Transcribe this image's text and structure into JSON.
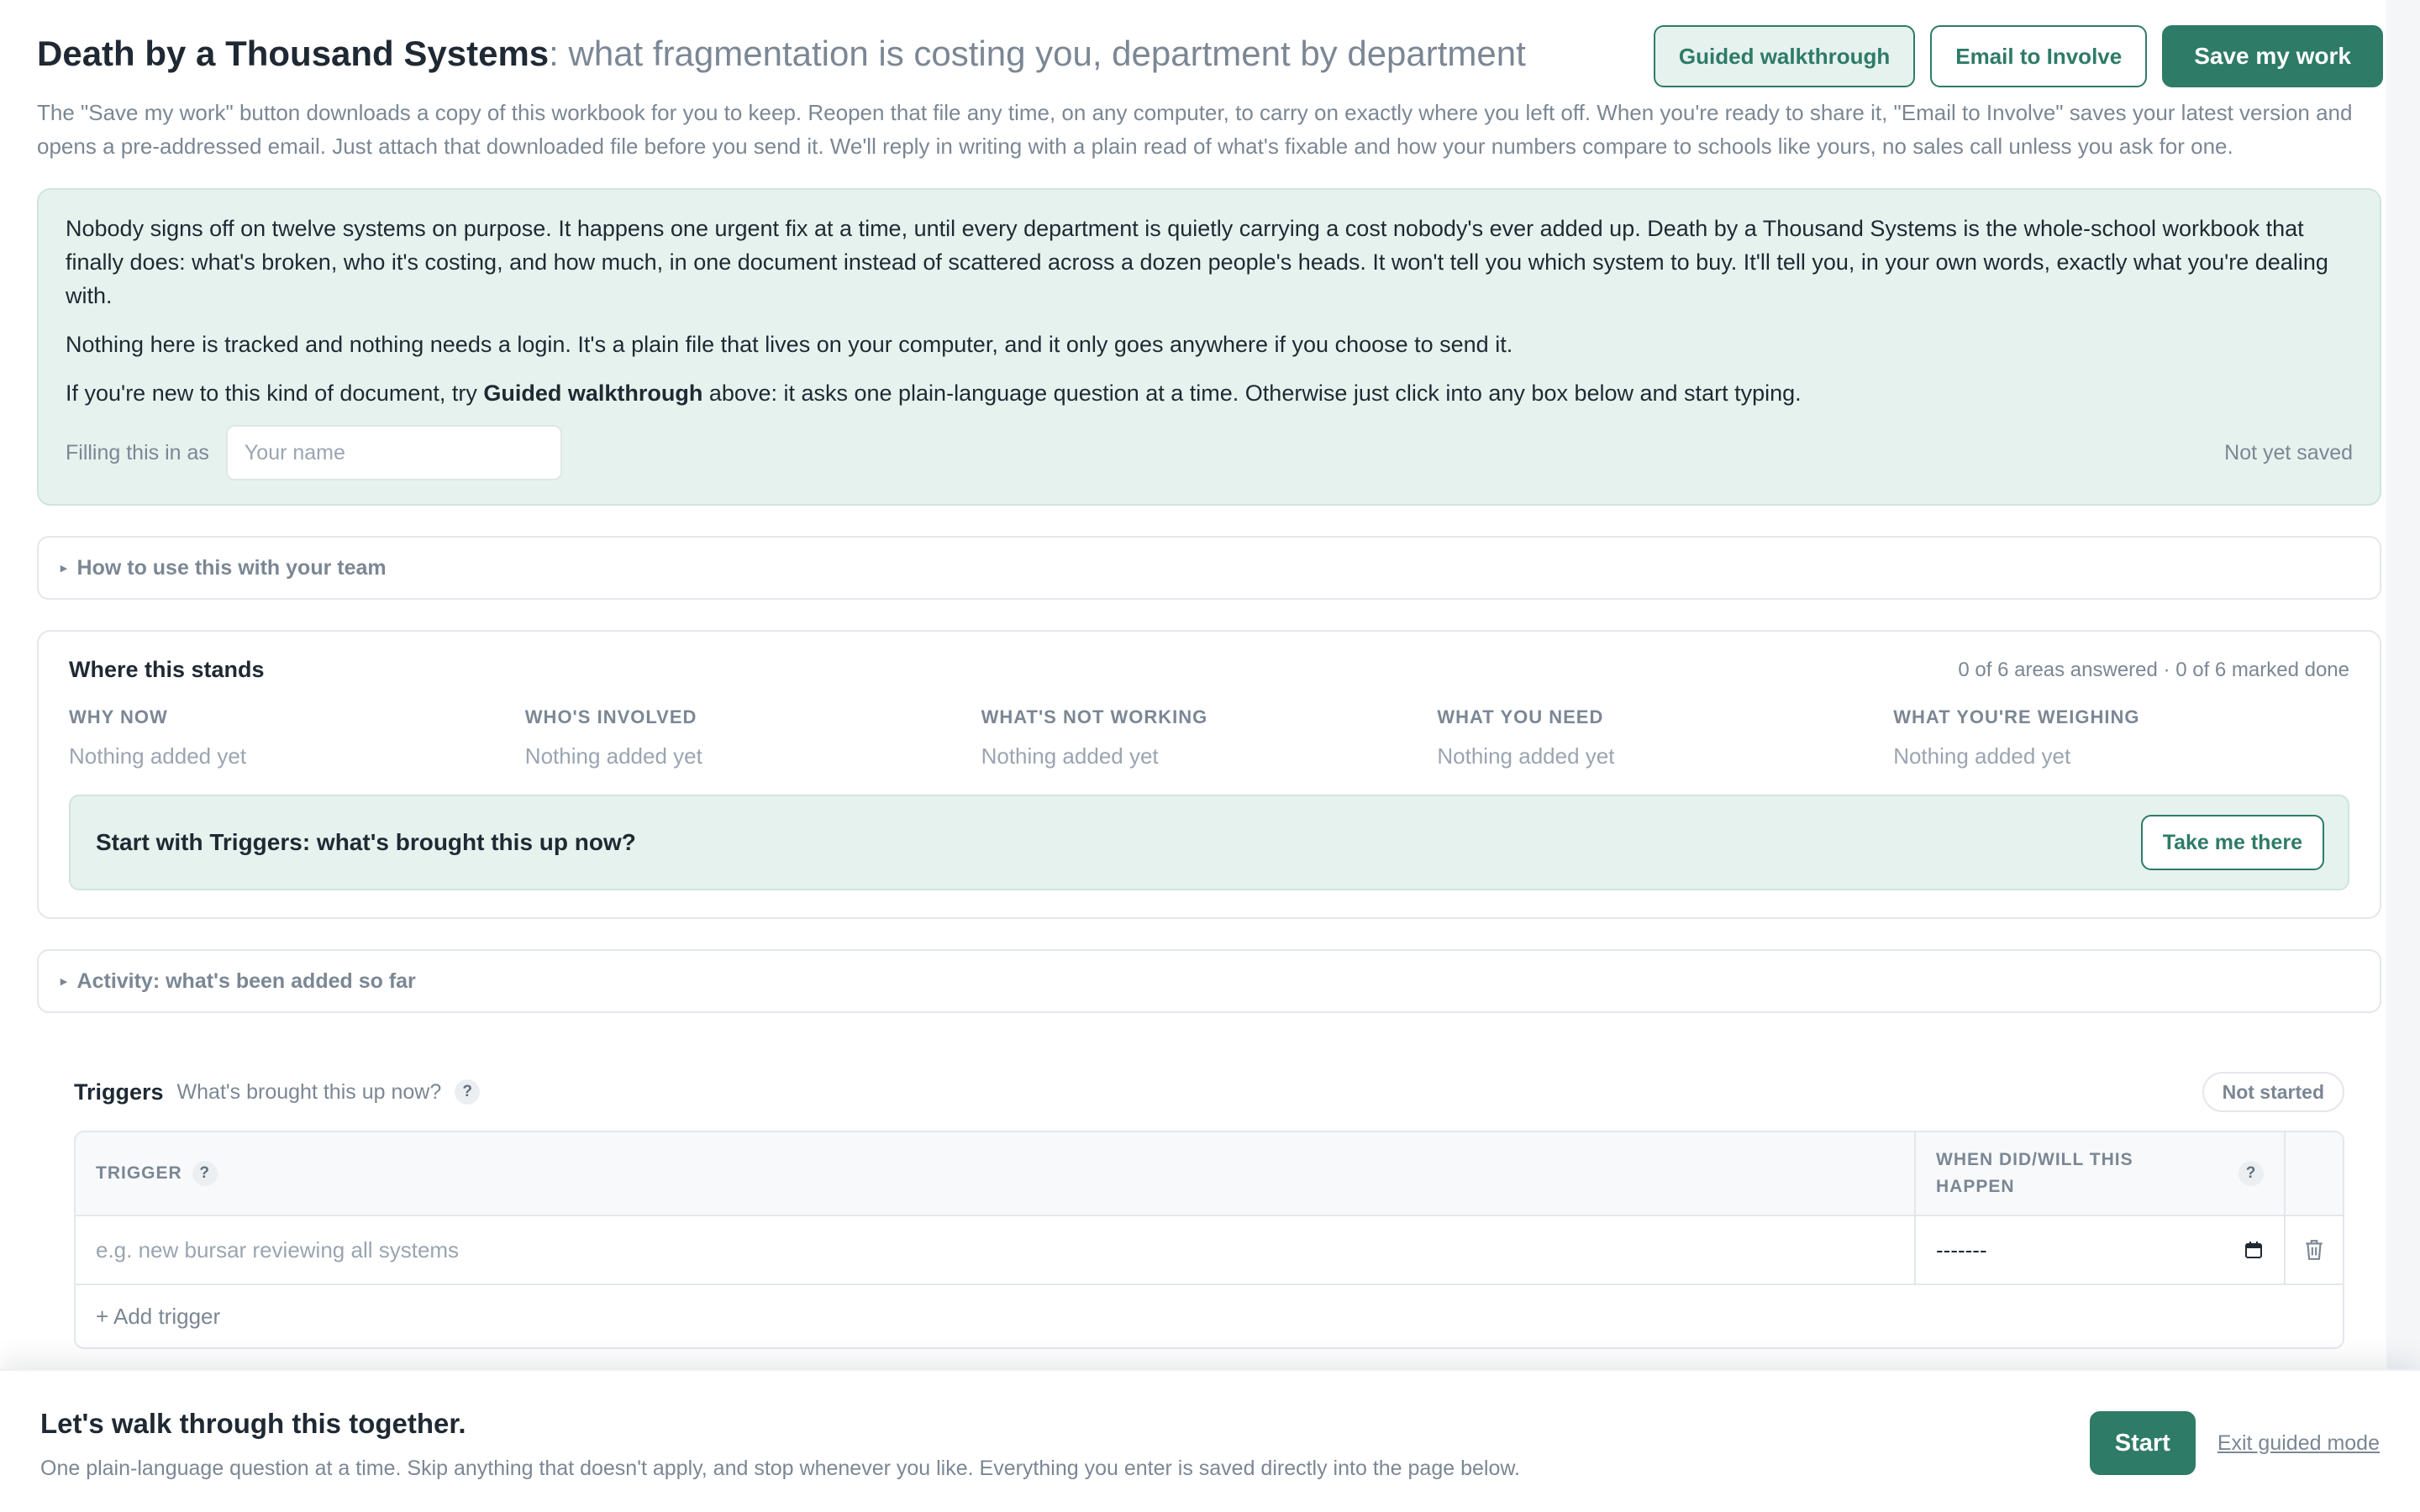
{
  "header": {
    "title": "Death by a Thousand Systems",
    "subtitle": ": what fragmentation is costing you, department by department",
    "guided_label": "Guided walkthrough",
    "email_label": "Email to Involve",
    "save_label": "Save my work",
    "intro": "The \"Save my work\" button downloads a copy of this workbook for you to keep. Reopen that file any time, on any computer, to carry on exactly where you left off. When you're ready to share it, \"Email to Involve\" saves your latest version and opens a pre-addressed email. Just attach that downloaded file before you send it. We'll reply in writing with a plain read of what's fixable and how your numbers compare to schools like yours, no sales call unless you ask for one."
  },
  "hero": {
    "p1": "Nobody signs off on twelve systems on purpose. It happens one urgent fix at a time, until every department is quietly carrying a cost nobody's ever added up. Death by a Thousand Systems is the whole-school workbook that finally does: what's broken, who it's costing, and how much, in one document instead of scattered across a dozen people's heads. It won't tell you which system to buy. It'll tell you, in your own words, exactly what you're dealing with.",
    "p2": "Nothing here is tracked and nothing needs a login. It's a plain file that lives on your computer, and it only goes anywhere if you choose to send it.",
    "p3_before": "If you're new to this kind of document, try ",
    "p3_bold": "Guided walkthrough",
    "p3_after": " above: it asks one plain-language question at a time. Otherwise just click into any box below and start typing.",
    "filling_label": "Filling this in as",
    "name_placeholder": "Your name",
    "save_state": "Not yet saved"
  },
  "how_to": {
    "label": "How to use this with your team"
  },
  "status": {
    "title": "Where this stands",
    "count": "0 of 6 areas answered · 0 of 6 marked done",
    "areas": [
      {
        "label": "WHY NOW",
        "value": "Nothing added yet"
      },
      {
        "label": "WHO'S INVOLVED",
        "value": "Nothing added yet"
      },
      {
        "label": "WHAT'S NOT WORKING",
        "value": "Nothing added yet"
      },
      {
        "label": "WHAT YOU NEED",
        "value": "Nothing added yet"
      },
      {
        "label": "WHAT YOU'RE WEIGHING",
        "value": "Nothing added yet"
      }
    ],
    "next_text": "Start with Triggers: what's brought this up now?",
    "next_button": "Take me there"
  },
  "activity": {
    "label": "Activity: what's been added so far"
  },
  "triggers": {
    "name": "Triggers",
    "question": "What's brought this up now?",
    "help": "?",
    "state": "Not started",
    "col_trigger": "TRIGGER",
    "col_when": "WHEN DID/WILL THIS HAPPEN",
    "row_placeholder": "e.g. new bursar reviewing all systems",
    "date_value": "-------",
    "add_label": "+ Add trigger"
  },
  "guide_bar": {
    "title": "Let's walk through this together.",
    "subtitle": "One plain-language question at a time. Skip anything that doesn't apply, and stop whenever you like. Everything you enter is saved directly into the page below.",
    "start_label": "Start",
    "exit_label": "Exit guided mode"
  },
  "colors": {
    "accent": "#2e7b67",
    "accent_soft": "#e6f2ee",
    "muted_text": "#7b8794",
    "border": "#e4e7eb"
  }
}
